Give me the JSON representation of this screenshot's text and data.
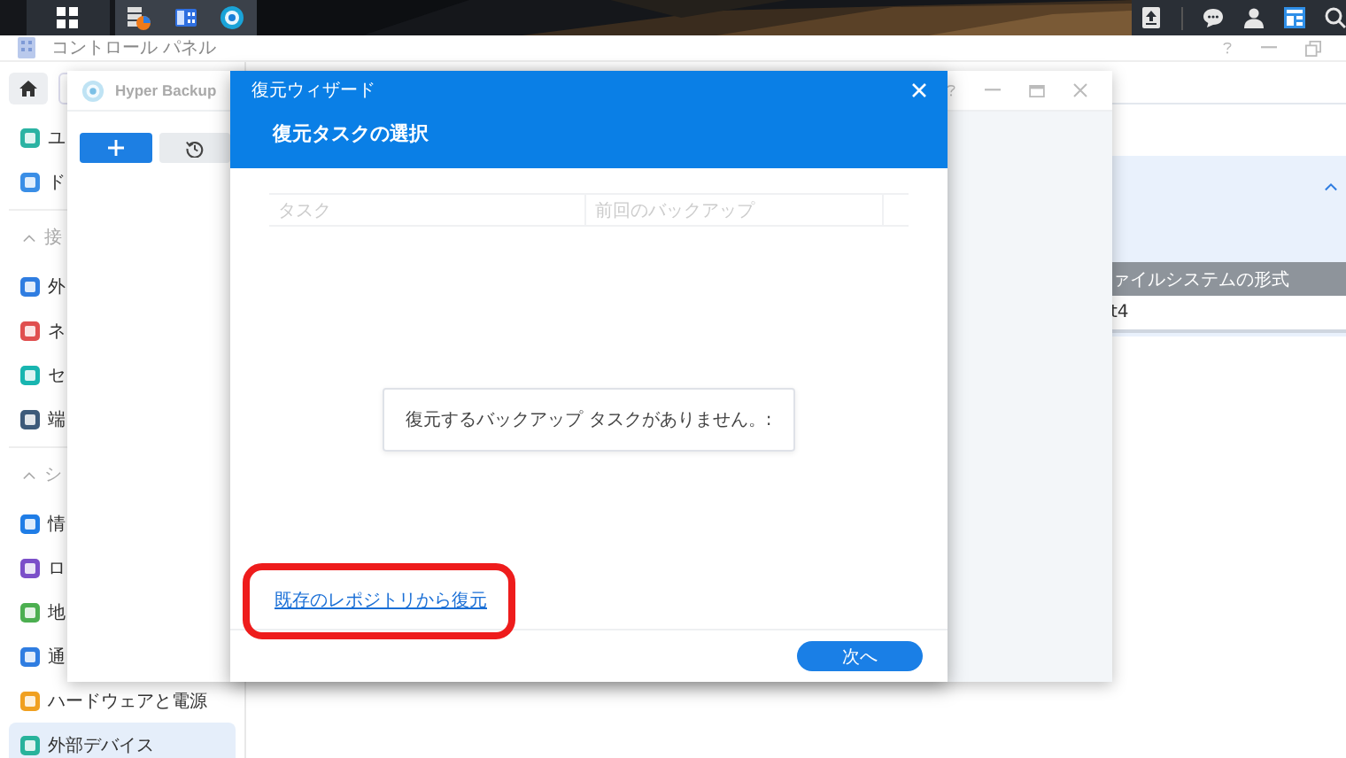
{
  "control_panel": {
    "title": "コントロール パネル",
    "sidebar": {
      "items": [
        {
          "kind": "item",
          "label": "ユ",
          "selected": false
        },
        {
          "kind": "item",
          "label": "ド",
          "selected": false
        },
        {
          "kind": "section",
          "label": "接",
          "expanded": true
        },
        {
          "kind": "item",
          "label": "外",
          "selected": false
        },
        {
          "kind": "item",
          "label": "ネ",
          "selected": false
        },
        {
          "kind": "item",
          "label": "セ",
          "selected": false
        },
        {
          "kind": "item",
          "label": "端",
          "selected": false
        },
        {
          "kind": "section",
          "label": "シ",
          "expanded": true
        },
        {
          "kind": "item",
          "label": "情",
          "selected": false
        },
        {
          "kind": "item",
          "label": "ロ",
          "selected": false
        },
        {
          "kind": "item",
          "label": "地",
          "selected": false
        },
        {
          "kind": "item",
          "label": "通",
          "selected": false
        },
        {
          "kind": "item",
          "label": "ハードウェアと電源",
          "selected": false
        },
        {
          "kind": "item",
          "label": "外部デバイス",
          "selected": true
        }
      ]
    },
    "panel": {
      "expanded": true,
      "table": {
        "columns": [
          "ァイルシステムの形式"
        ],
        "rows": [
          [
            "t4"
          ]
        ]
      }
    }
  },
  "hyper_backup": {
    "title": "Hyper Backup"
  },
  "dialog": {
    "title": "復元ウィザード",
    "heading": "復元タスクの選択",
    "table": {
      "columns": [
        "タスク",
        "前回のバックアップ"
      ]
    },
    "empty_message": "復元するバックアップ タスクがありません。:",
    "link": "既存のレポジトリから復元",
    "buttons": [
      "次へ"
    ]
  }
}
